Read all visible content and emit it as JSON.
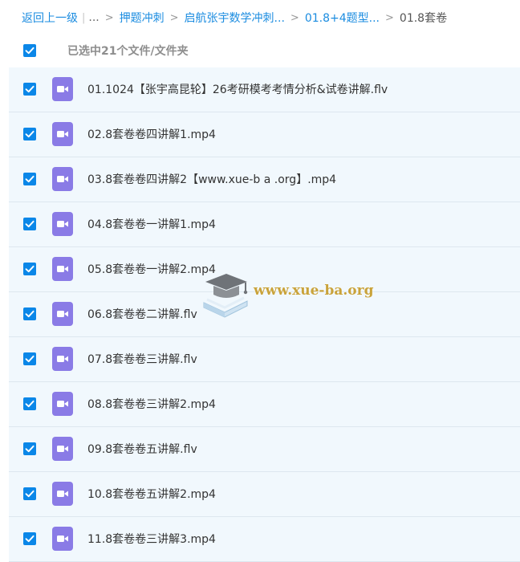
{
  "breadcrumb": {
    "back": "返回上一级",
    "ellipsis": "...",
    "items": [
      "押题冲刺",
      "启航张宇数学冲刺...",
      "01.8+4题型..."
    ],
    "current": "01.8套卷"
  },
  "selection": {
    "label": "已选中21个文件/文件夹",
    "checked": true
  },
  "files": [
    {
      "name": "01.1024【张宇高昆轮】26考研模考考情分析&试卷讲解.flv",
      "checked": true
    },
    {
      "name": "02.8套卷卷四讲解1.mp4",
      "checked": true
    },
    {
      "name": "03.8套卷卷四讲解2【www.xue-b a .org】.mp4",
      "checked": true
    },
    {
      "name": "04.8套卷卷一讲解1.mp4",
      "checked": true
    },
    {
      "name": "05.8套卷卷一讲解2.mp4",
      "checked": true
    },
    {
      "name": "06.8套卷卷二讲解.flv",
      "checked": true
    },
    {
      "name": "07.8套卷卷三讲解.flv",
      "checked": true
    },
    {
      "name": "08.8套卷卷三讲解2.mp4",
      "checked": true
    },
    {
      "name": "09.8套卷卷五讲解.flv",
      "checked": true
    },
    {
      "name": "10.8套卷卷五讲解2.mp4",
      "checked": true
    },
    {
      "name": "11.8套卷卷三讲解3.mp4",
      "checked": true
    }
  ],
  "watermark": {
    "text": "www.xue-ba.org",
    "icon": "graduation-cap-book-logo"
  },
  "colors": {
    "link": "#1b8ce0",
    "checkbox": "#0b87e8",
    "video_icon": "#8a7be6",
    "row_background": "#f1f8fd",
    "watermark_text": "#c9a33b"
  },
  "icons": {
    "checkbox": "check-icon",
    "file": "video-file-icon"
  }
}
